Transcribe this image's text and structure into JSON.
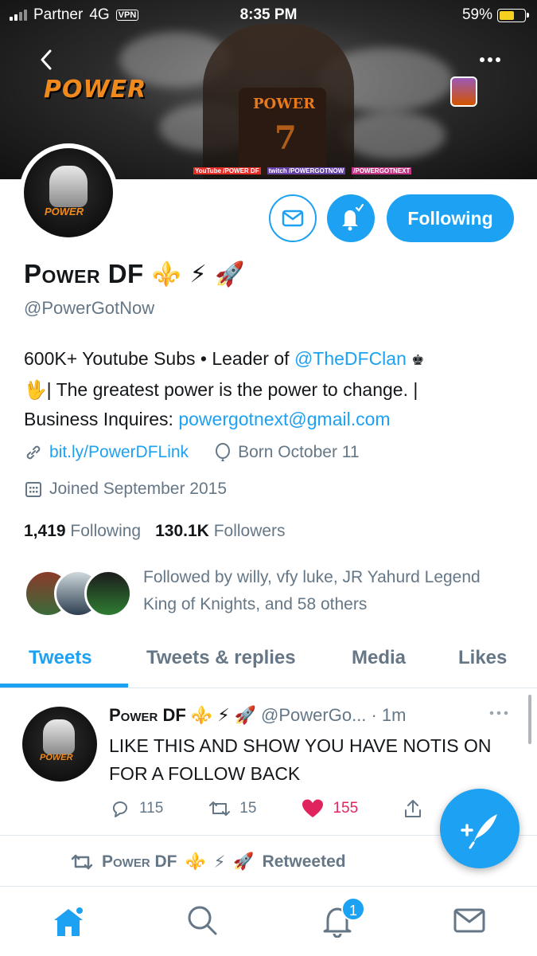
{
  "status_bar": {
    "carrier": "Partner",
    "network": "4G",
    "vpn": "VPN",
    "time": "8:35 PM",
    "battery_percent": "59%",
    "battery_level": 0.59
  },
  "banner": {
    "logo_text": "POWER",
    "jersey_text": "POWER",
    "jersey_number": "7",
    "social_youtube": "YouTube /POWER DF",
    "social_twitch": "twitch /POWERGOTNOW",
    "social_instagram": "/POWERGOTNEXT"
  },
  "profile": {
    "avatar_tag": "POWER",
    "display_name": "Power DF",
    "name_emojis": [
      "⚜️",
      "⚡",
      "🚀"
    ],
    "handle": "@PowerGotNow",
    "bio_line1_prefix": "600K+ Youtube Subs • Leader of ",
    "bio_mention": "@TheDFClan",
    "bio_crown": "♚",
    "bio_line2_emoji": "🖖",
    "bio_line2": "| The greatest power is the power to change. |",
    "bio_line3_prefix": "Business Inquires: ",
    "bio_email": "powergotnext@gmail.com",
    "website": "bit.ly/PowerDFLink",
    "birthday": "Born October 11",
    "joined": "Joined September 2015",
    "following_count": "1,419",
    "following_label": "Following",
    "followers_count": "130.1K",
    "followers_label": "Followers",
    "followed_by": "Followed by willy, vfy luke, JR Yahurd Legend King of Knights, and 58 others"
  },
  "actions": {
    "follow_label": "Following"
  },
  "tabs": [
    {
      "label": "Tweets",
      "active": true
    },
    {
      "label": "Tweets & replies",
      "active": false
    },
    {
      "label": "Media",
      "active": false
    },
    {
      "label": "Likes",
      "active": false
    }
  ],
  "tweet": {
    "avatar_tag": "POWER",
    "name": "Power DF",
    "emojis": [
      "⚜️",
      "⚡",
      "🚀"
    ],
    "handle": "@PowerGo...",
    "time": "· 1m",
    "text": "LIKE THIS AND SHOW YOU HAVE NOTIS ON FOR A FOLLOW BACK",
    "replies": "115",
    "retweets": "15",
    "likes": "155"
  },
  "retweet_row": {
    "name": "Power DF",
    "emojis": [
      "⚜️",
      "⚡",
      "🚀"
    ],
    "label": "Retweeted"
  },
  "bottom_nav": {
    "notifications_badge": "1"
  },
  "colors": {
    "accent": "#1da1f2",
    "text": "#14171a",
    "muted": "#657786",
    "like": "#e0245e"
  }
}
